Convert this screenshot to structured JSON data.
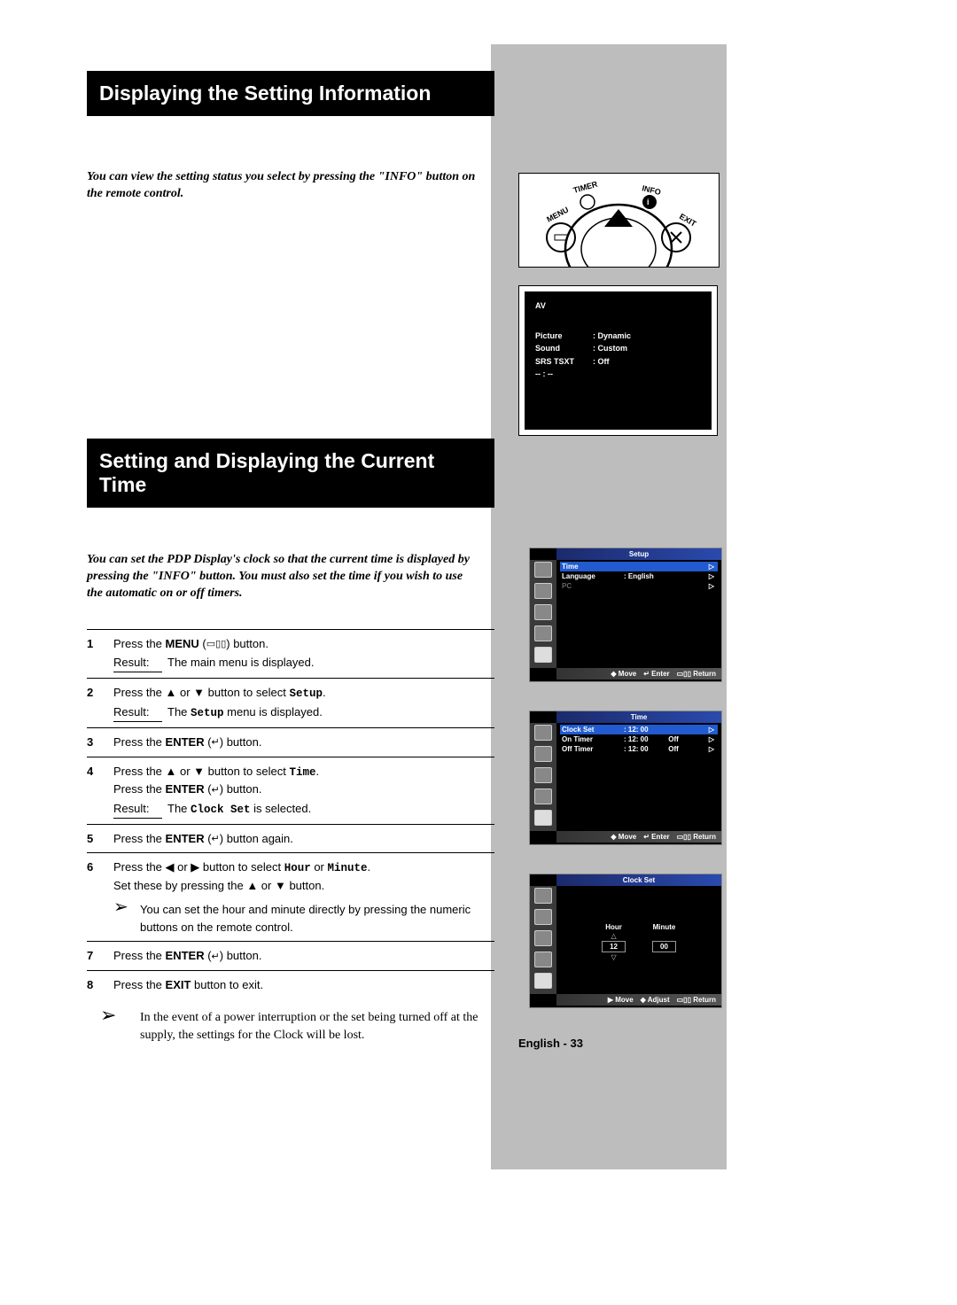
{
  "headings": {
    "section1": "Displaying the Setting Information",
    "section2": "Setting and Displaying the Current Time"
  },
  "intro1": "You can view the setting status you select by pressing the \"INFO\" button on the remote control.",
  "intro2": "You can set the PDP Display's clock so that the current time is displayed by pressing the \"INFO\" button. You must also set the time if you wish to use the automatic on or off timers.",
  "remote": {
    "labels": {
      "menu": "MENU",
      "timer": "TIMER",
      "info": "INFO",
      "exit": "EXIT"
    }
  },
  "info_display": {
    "mode": "AV",
    "rows": [
      {
        "label": "Picture",
        "value": "Dynamic"
      },
      {
        "label": "Sound",
        "value": "Custom"
      },
      {
        "label": "SRS TSXT",
        "value": "Off"
      }
    ],
    "time": "-- : --"
  },
  "steps": [
    {
      "num": "1",
      "body_parts": [
        "Press the ",
        {
          "b": "MENU"
        },
        " (",
        {
          "g": "▭▯▯"
        },
        ") button."
      ],
      "result": [
        "The main menu is displayed."
      ]
    },
    {
      "num": "2",
      "body_parts": [
        "Press the ▲ or ▼ button to select ",
        {
          "m": "Setup"
        },
        "."
      ],
      "result": [
        "The ",
        {
          "m": "Setup"
        },
        " menu is displayed."
      ]
    },
    {
      "num": "3",
      "body_parts": [
        "Press the ",
        {
          "b": "ENTER"
        },
        " (",
        {
          "g": "↵"
        },
        ") button."
      ]
    },
    {
      "num": "4",
      "body_parts": [
        "Press the ▲ or ▼ button to select ",
        {
          "m": "Time"
        },
        ".",
        {
          "br": true
        },
        "Press the ",
        {
          "b": "ENTER"
        },
        " (",
        {
          "g": "↵"
        },
        ") button."
      ],
      "result": [
        "The ",
        {
          "m": "Clock Set"
        },
        " is selected."
      ]
    },
    {
      "num": "5",
      "body_parts": [
        "Press the ",
        {
          "b": "ENTER"
        },
        " (",
        {
          "g": "↵"
        },
        ") button again."
      ]
    },
    {
      "num": "6",
      "body_parts": [
        "Press the ◀ or ▶ button to select ",
        {
          "m": "Hour"
        },
        " or ",
        {
          "m": "Minute"
        },
        ".",
        {
          "br": true
        },
        "Set these by pressing the ▲ or ▼ button."
      ],
      "note": "You can set the hour and minute directly by pressing the numeric buttons on the remote control."
    },
    {
      "num": "7",
      "body_parts": [
        "Press the ",
        {
          "b": "ENTER"
        },
        " (",
        {
          "g": "↵"
        },
        ") button."
      ]
    },
    {
      "num": "8",
      "body_parts": [
        "Press the ",
        {
          "b": "EXIT"
        },
        " button to exit."
      ]
    }
  ],
  "footer_note": "In the event of a power interruption or the set being turned off at the supply, the settings for the Clock will be lost.",
  "osd": {
    "setup": {
      "title": "Setup",
      "rows": [
        {
          "label": "Time",
          "value": "",
          "selected": true,
          "caret": "▷"
        },
        {
          "label": "Language",
          "value": "English",
          "caret": "▷"
        },
        {
          "label": "PC",
          "value": "",
          "dim": true,
          "caret": "▷"
        }
      ],
      "foot": [
        "◆ Move",
        "↵ Enter",
        "▭▯▯ Return"
      ]
    },
    "time": {
      "title": "Time",
      "rows": [
        {
          "label": "Clock Set",
          "value": "12: 00",
          "state": "",
          "selected": true,
          "caret": "▷"
        },
        {
          "label": "On Timer",
          "value": "12: 00",
          "state": "Off",
          "caret": "▷"
        },
        {
          "label": "Off Timer",
          "value": "12: 00",
          "state": "Off",
          "caret": "▷"
        }
      ],
      "foot": [
        "◆ Move",
        "↵ Enter",
        "▭▯▯ Return"
      ]
    },
    "clockset": {
      "title": "Clock Set",
      "hour_label": "Hour",
      "minute_label": "Minute",
      "hour_value": "12",
      "minute_value": "00",
      "foot": [
        "▶ Move",
        "◆ Adjust",
        "▭▯▯ Return"
      ]
    }
  },
  "page_foot": "English - 33",
  "result_label": "Result:"
}
